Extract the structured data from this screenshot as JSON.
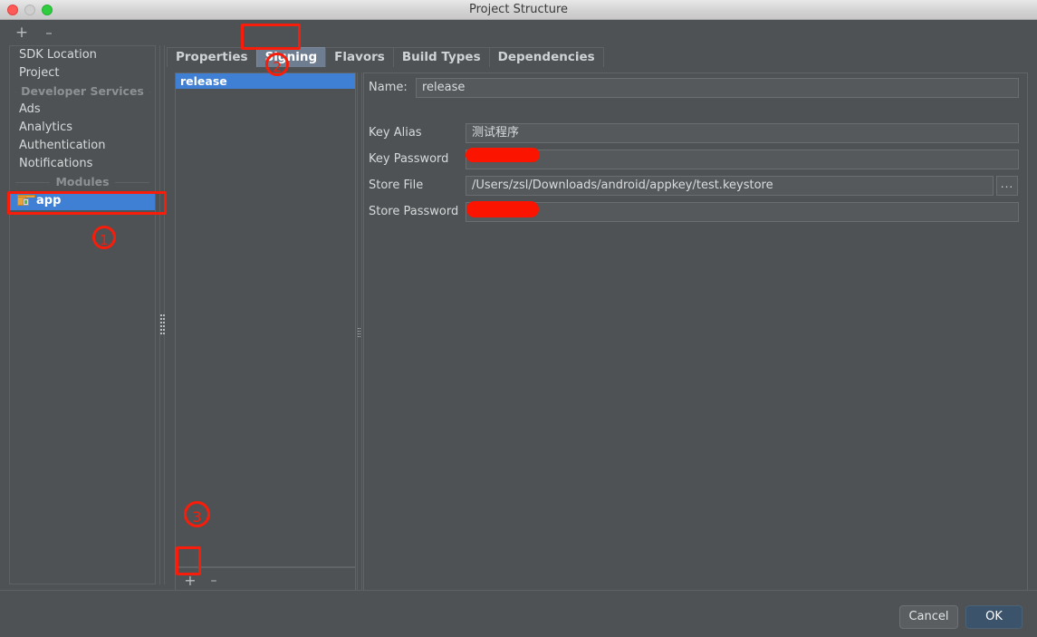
{
  "window": {
    "title": "Project Structure",
    "traffic_lights": [
      "close-red",
      "minimize-gray",
      "maximize-green"
    ]
  },
  "left_toolbar": {
    "add_label": "+",
    "remove_label": "–"
  },
  "sidebar": {
    "items": [
      {
        "type": "item",
        "label": "SDK Location"
      },
      {
        "type": "item",
        "label": "Project"
      },
      {
        "type": "separator",
        "label": "Developer Services"
      },
      {
        "type": "item",
        "label": "Ads"
      },
      {
        "type": "item",
        "label": "Analytics"
      },
      {
        "type": "item",
        "label": "Authentication"
      },
      {
        "type": "item",
        "label": "Notifications"
      },
      {
        "type": "separator",
        "label": "Modules"
      },
      {
        "type": "module",
        "label": "app",
        "selected": true
      }
    ]
  },
  "tabs": [
    {
      "label": "Properties",
      "active": false
    },
    {
      "label": "Signing",
      "active": true
    },
    {
      "label": "Flavors",
      "active": false
    },
    {
      "label": "Build Types",
      "active": false
    },
    {
      "label": "Dependencies",
      "active": false
    }
  ],
  "config_list": {
    "items": [
      {
        "label": "release",
        "selected": true
      }
    ],
    "add_label": "+",
    "remove_label": "–"
  },
  "form": {
    "name": {
      "label": "Name:",
      "value": "release"
    },
    "fields": [
      {
        "label": "Key Alias",
        "value": "测试程序",
        "redacted": false,
        "browse": false
      },
      {
        "label": "Key Password",
        "value": "",
        "redacted": true,
        "browse": false
      },
      {
        "label": "Store File",
        "value": "/Users/zsl/Downloads/android/appkey/test.keystore",
        "redacted": false,
        "browse": true,
        "browse_label": "..."
      },
      {
        "label": "Store Password",
        "value": "",
        "redacted": true,
        "browse": false
      }
    ]
  },
  "footer": {
    "cancel_label": "Cancel",
    "ok_label": "OK"
  },
  "annotations": {
    "step1": "1",
    "step2": "2",
    "step3": "3"
  },
  "colors": {
    "accent_selection": "#3f7fd4",
    "annotation_red": "#f81d0a",
    "redaction_red": "#fb1400",
    "tab_active": "#6f7d90",
    "ok_button": "#3c536c",
    "panel_bg": "#4e5254"
  }
}
